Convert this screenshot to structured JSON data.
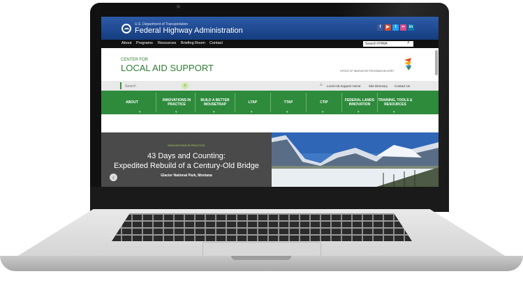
{
  "header": {
    "department": "U.S. Department of Transportation",
    "agency": "Federal Highway Administration"
  },
  "top_nav": [
    "About",
    "Programs",
    "Resources",
    "Briefing Room",
    "Contact"
  ],
  "top_search": {
    "value": "Search FHWA"
  },
  "branding": {
    "line1": "CENTER FOR",
    "line2": "LOCAL AID SUPPORT",
    "office": "OFFICE OF INNOVATIVE PROGRAM DELIVERY"
  },
  "site_search": {
    "placeholder": "Search"
  },
  "utility_links": [
    "Local Aid Support Home",
    "Site Directory",
    "Contact Us"
  ],
  "main_nav": [
    {
      "line1": "ABOUT",
      "line2": ""
    },
    {
      "line1": "INNOVATIONS IN",
      "line2": "PRACTICE"
    },
    {
      "line1": "BUILD A BETTER",
      "line2": "MOUSETRAP"
    },
    {
      "line1": "LTAP",
      "line2": ""
    },
    {
      "line1": "TTAP",
      "line2": ""
    },
    {
      "line1": "CTIP",
      "line2": ""
    },
    {
      "line1": "FEDERAL LANDS",
      "line2": "INNOVATION"
    },
    {
      "line1": "TRAINING, TOOLS &",
      "line2": "RESOURCES"
    }
  ],
  "hero": {
    "tag": "INNOVATIONS IN PRACTICE",
    "title_line1": "43 Days and Counting:",
    "title_line2": "Expedited Rebuild of a Century-Old Bridge",
    "location": "Glacier National Park, Montana"
  },
  "colors": {
    "brand_blue": "#1f4b94",
    "brand_green": "#2e8b3c"
  }
}
